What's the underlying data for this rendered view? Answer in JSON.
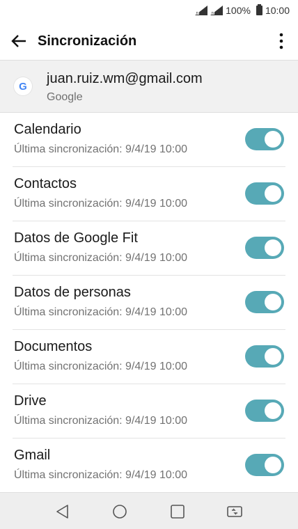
{
  "status_bar": {
    "battery_text": "100%",
    "time": "10:00"
  },
  "app_bar": {
    "title": "Sincronización",
    "back_icon": "back-arrow-icon",
    "menu_icon": "more-vert-icon"
  },
  "account": {
    "email": "juan.ruiz.wm@gmail.com",
    "type": "Google",
    "icon_letter": "G"
  },
  "sync_items": [
    {
      "title": "Calendario",
      "subtitle": "Última sincronización: 9/4/19 10:00",
      "enabled": true
    },
    {
      "title": "Contactos",
      "subtitle": "Última sincronización: 9/4/19 10:00",
      "enabled": true
    },
    {
      "title": "Datos de Google Fit",
      "subtitle": "Última sincronización: 9/4/19 10:00",
      "enabled": true
    },
    {
      "title": "Datos de personas",
      "subtitle": "Última sincronización: 9/4/19 10:00",
      "enabled": true
    },
    {
      "title": "Documentos",
      "subtitle": "Última sincronización: 9/4/19 10:00",
      "enabled": true
    },
    {
      "title": "Drive",
      "subtitle": "Última sincronización: 9/4/19 10:00",
      "enabled": true
    },
    {
      "title": "Gmail",
      "subtitle": "Última sincronización: 9/4/19 10:00",
      "enabled": true
    }
  ],
  "colors": {
    "toggle_on": "#57a9b6",
    "account_bg": "#f1f1f1",
    "nav_bg": "#eeeeee"
  }
}
